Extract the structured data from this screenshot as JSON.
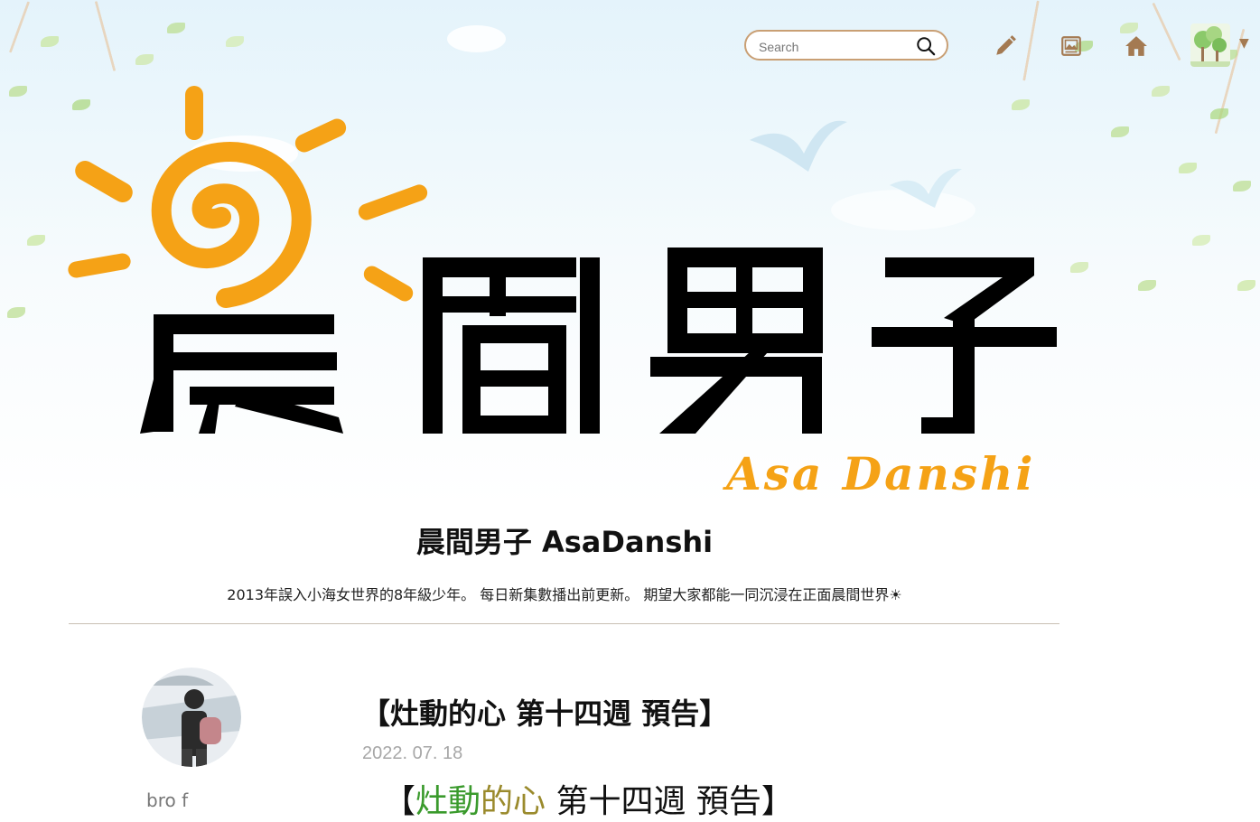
{
  "header": {
    "search": {
      "placeholder": "Search",
      "value": ""
    },
    "icons": [
      "search-icon",
      "pencil-icon",
      "image-icon",
      "home-icon"
    ],
    "accent_color": "#c99f74"
  },
  "logo": {
    "chinese": "晨間男子",
    "latin": "Asa Danshi",
    "sun_color": "#f5a216"
  },
  "blog": {
    "title": "晨間男子 AsaDanshi",
    "description": "2013年誤入小海女世界的8年級少年。 每日新集數播出前更新。 期望大家都能一同沉浸在正面晨間世界☀"
  },
  "post": {
    "author_partial": "bro f",
    "title": "【灶動的心 第十四週 預告】",
    "date": "2022. 07. 18",
    "heading_parts": [
      "【",
      "灶動",
      "的心",
      " 第十四週 預告】"
    ]
  }
}
